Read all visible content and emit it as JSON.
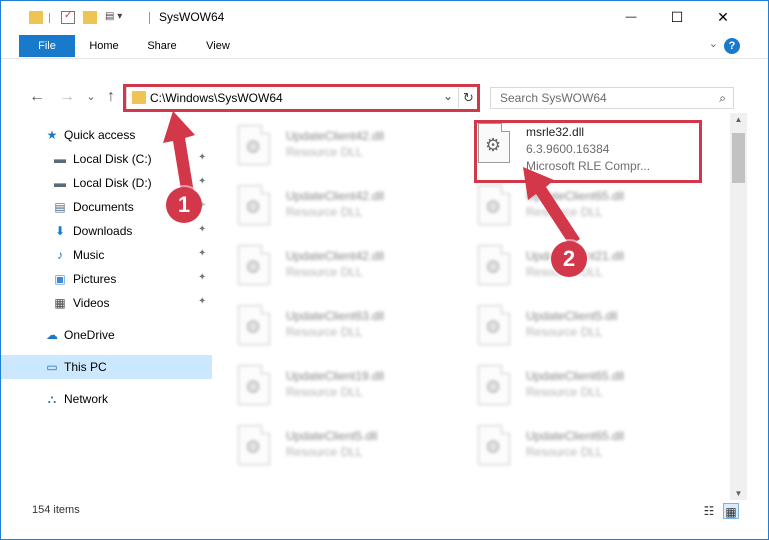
{
  "window": {
    "title": "SysWOW64",
    "minimize": "—",
    "maximize": "☐",
    "close": "✕"
  },
  "ribbon": {
    "tabs": [
      "File",
      "Home",
      "Share",
      "View"
    ],
    "help": "?",
    "collapse": "⌄"
  },
  "nav": {
    "back": "←",
    "forward": "→",
    "recent": "⌄",
    "up": "↑",
    "address": "C:\\Windows\\SysWOW64",
    "address_chevron": "⌄",
    "refresh": "↻",
    "search_placeholder": "Search SysWOW64",
    "search_icon": "⌕"
  },
  "sidebar": {
    "items": [
      {
        "label": "Quick access",
        "icon": "star-icon",
        "glyph": "★",
        "color": "#1979ca",
        "pinned": false
      },
      {
        "label": "Local Disk (C:)",
        "icon": "drive-icon",
        "glyph": "▬",
        "color": "#5a6c7a",
        "pinned": true
      },
      {
        "label": "Local Disk (D:)",
        "icon": "drive-icon",
        "glyph": "▬",
        "color": "#5a6c7a",
        "pinned": true
      },
      {
        "label": "Documents",
        "icon": "document-icon",
        "glyph": "▤",
        "color": "#4a6a88",
        "pinned": true
      },
      {
        "label": "Downloads",
        "icon": "download-icon",
        "glyph": "⬇",
        "color": "#1979ca",
        "pinned": true
      },
      {
        "label": "Music",
        "icon": "music-icon",
        "glyph": "♪",
        "color": "#2b6fb5",
        "pinned": true
      },
      {
        "label": "Pictures",
        "icon": "pictures-icon",
        "glyph": "▣",
        "color": "#3a8ad8",
        "pinned": true
      },
      {
        "label": "Videos",
        "icon": "video-icon",
        "glyph": "▦",
        "color": "#444444",
        "pinned": true
      },
      {
        "label": "OneDrive",
        "icon": "cloud-icon",
        "glyph": "☁",
        "color": "#1979ca",
        "pinned": false
      },
      {
        "label": "This PC",
        "icon": "computer-icon",
        "glyph": "▭",
        "color": "#2b6fb5",
        "pinned": false
      },
      {
        "label": "Network",
        "icon": "network-icon",
        "glyph": "⛬",
        "color": "#2b6fb5",
        "pinned": false
      }
    ],
    "selected": "This PC",
    "pin_glyph": "📌"
  },
  "files": {
    "left_column": [
      {
        "name": "UpdateClient42.dll",
        "type": "Resource DLL"
      },
      {
        "name": "UpdateClient42.dll",
        "type": "Resource DLL"
      },
      {
        "name": "UpdateClient42.dll",
        "type": "Resource DLL"
      },
      {
        "name": "UpdateClient63.dll",
        "type": "Resource DLL"
      },
      {
        "name": "UpdateClient19.dll",
        "type": "Resource DLL"
      },
      {
        "name": "UpdateClient5.dll",
        "type": "Resource DLL"
      }
    ],
    "right_column": [
      {
        "name": "msrle32.dll",
        "version": "6.3.9600.16384",
        "description": "Microsoft RLE Compr..."
      },
      {
        "name": "UpdateClient65.dll",
        "type": "Resource DLL"
      },
      {
        "name": "UpdateClient21.dll",
        "type": "Resource DLL"
      },
      {
        "name": "UpdateClient5.dll",
        "type": "Resource DLL"
      },
      {
        "name": "UpdateClient65.dll",
        "type": "Resource DLL"
      },
      {
        "name": "UpdateClient65.dll",
        "type": "Resource DLL"
      }
    ]
  },
  "status": {
    "items_count": "154 items"
  },
  "annotations": {
    "step1": "1",
    "step2": "2",
    "highlight_color": "#d2374a"
  },
  "colors": {
    "accent": "#1979ca",
    "selection": "#cce8ff",
    "annotation": "#d2374a"
  }
}
